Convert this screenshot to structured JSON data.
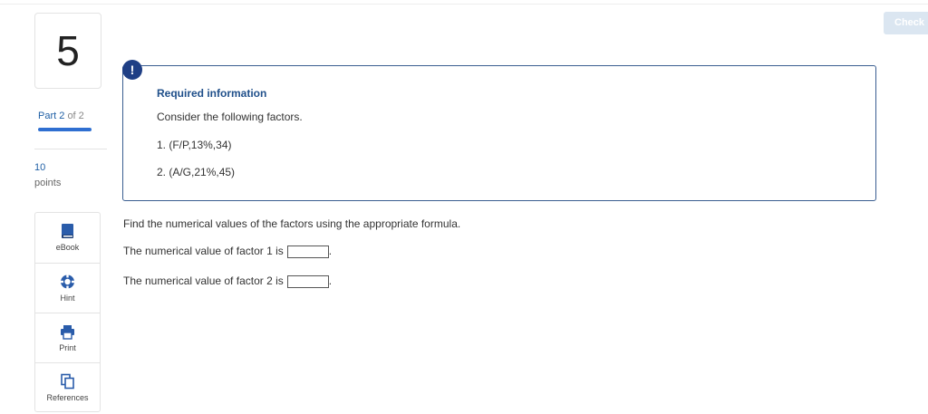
{
  "question": {
    "number": "5"
  },
  "part": {
    "label": "Part",
    "current": "2",
    "of_text": "of 2",
    "progress": 1.0
  },
  "points": {
    "value": "10",
    "label": "points"
  },
  "tools": [
    {
      "label": "eBook",
      "icon": "book-icon"
    },
    {
      "label": "Hint",
      "icon": "lifebuoy-icon"
    },
    {
      "label": "Print",
      "icon": "printer-icon"
    },
    {
      "label": "References",
      "icon": "references-icon"
    }
  ],
  "check_button": {
    "label": "Check"
  },
  "required_info": {
    "title": "Required information",
    "intro": "Consider the following factors.",
    "factor1": "1. (F/P,13%,34)",
    "factor2": "2. (A/G,21%,45)"
  },
  "question_text": {
    "prompt": "Find the numerical values of the factors using the appropriate formula.",
    "line1": "The numerical value of factor 1 is",
    "line2": "The numerical value of factor 2 is",
    "answer1": "",
    "answer2": "",
    "period": "."
  },
  "colors": {
    "accent": "#1f5fa5",
    "progress": "#2f6fd1",
    "alert": "#1f3f85",
    "box_border": "#3a5e91"
  }
}
